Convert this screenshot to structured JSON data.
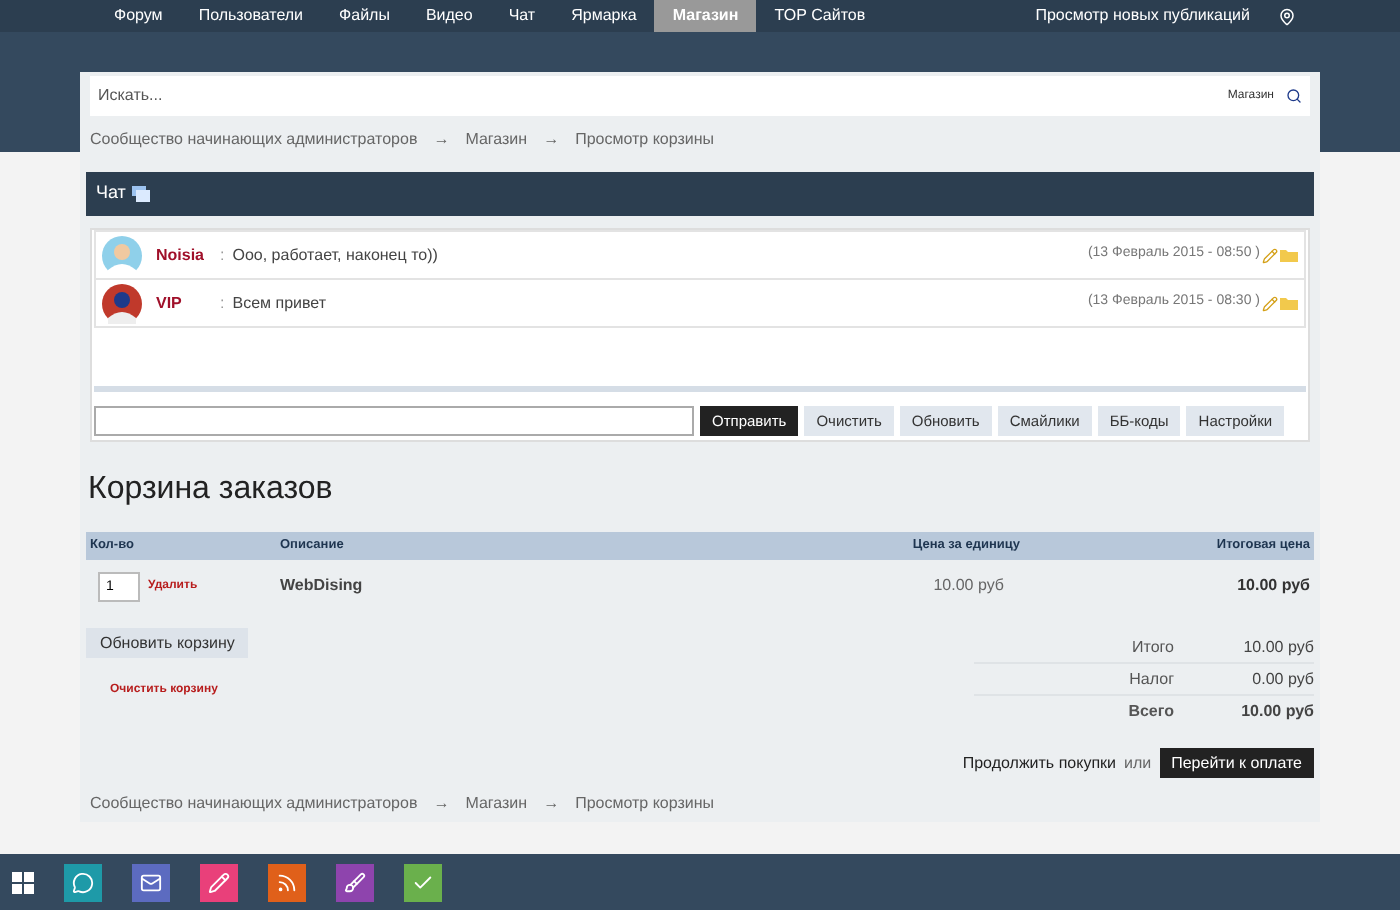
{
  "nav": {
    "items": [
      {
        "label": "Форум",
        "selected": false
      },
      {
        "label": "Пользователи",
        "selected": false
      },
      {
        "label": "Файлы",
        "selected": false
      },
      {
        "label": "Видео",
        "selected": false
      },
      {
        "label": "Чат",
        "selected": false
      },
      {
        "label": "Ярмарка",
        "selected": false
      },
      {
        "label": "Магазин",
        "selected": true
      },
      {
        "label": "TOP Сайтов",
        "selected": false
      }
    ],
    "right_link": "Просмотр новых публикаций"
  },
  "search": {
    "placeholder": "Искать...",
    "scope": "Магазин"
  },
  "breadcrumb": {
    "items": [
      "Сообщество начинающих администраторов",
      "Магазин",
      "Просмотр корзины"
    ],
    "separators": [
      "→",
      "→"
    ]
  },
  "chat": {
    "title": "Чат",
    "messages": [
      {
        "user": "Noisia",
        "separator": ":",
        "text": "Ооо, работает, наконец то))",
        "time": "(13 Февраль 2015 - 08:50 )"
      },
      {
        "user": "VIP",
        "separator": ":",
        "text": "Всем привет",
        "time": "(13 Февраль 2015 - 08:30 )"
      }
    ],
    "buttons": [
      {
        "label": "Отправить",
        "kind": "primary"
      },
      {
        "label": "Очистить",
        "kind": "secondary"
      },
      {
        "label": "Обновить",
        "kind": "secondary"
      },
      {
        "label": "Смайлики",
        "kind": "secondary"
      },
      {
        "label": "ББ-коды",
        "kind": "secondary"
      },
      {
        "label": "Настройки",
        "kind": "secondary"
      }
    ]
  },
  "cart": {
    "title": "Корзина заказов",
    "columns": [
      "Кол-во",
      "Описание",
      "Цена за единицу",
      "Итоговая цена"
    ],
    "rows": [
      {
        "qty": "1",
        "remove": "Удалить",
        "description": "WebDising",
        "unit_price": "10.00 руб",
        "total": "10.00 руб"
      }
    ],
    "update_button": "Обновить корзину",
    "clear_link": "Очистить корзину",
    "totals": [
      {
        "label": "Итого",
        "value": "10.00 руб",
        "bold": false
      },
      {
        "label": "Налог",
        "value": "0.00 руб",
        "bold": false
      },
      {
        "label": "Всего",
        "value": "10.00 руб",
        "bold": true
      }
    ],
    "continue_link": "Продолжить покупки",
    "or": "или",
    "checkout_button": "Перейти к оплате"
  },
  "footer_breadcrumb": {
    "items": [
      "Сообщество начинающих администраторов",
      "Магазин",
      "Просмотр корзины"
    ],
    "separators": [
      "→",
      "→"
    ]
  },
  "taskbar": [
    {
      "kind": "chat",
      "color": "#1e9aa8"
    },
    {
      "kind": "mail",
      "color": "#5c6bc0"
    },
    {
      "kind": "pencil",
      "color": "#e9407a"
    },
    {
      "kind": "rss",
      "color": "#e0601a"
    },
    {
      "kind": "brush",
      "color": "#8e44ad"
    },
    {
      "kind": "check",
      "color": "#6ab04c"
    }
  ]
}
